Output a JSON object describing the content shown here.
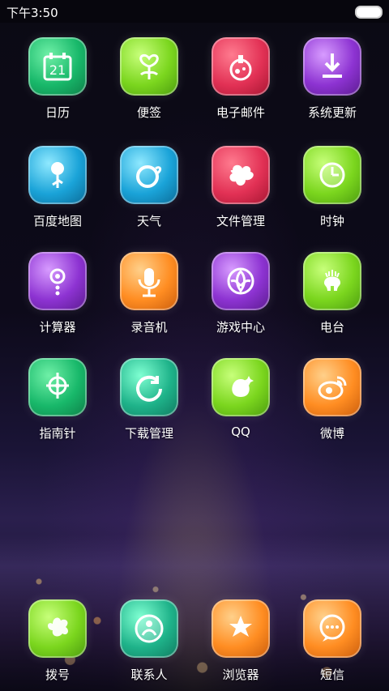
{
  "status_bar": {
    "time": "下午3:50"
  },
  "apps": [
    {
      "label": "日历",
      "icon": "calendar-icon",
      "badge": "21"
    },
    {
      "label": "便签",
      "icon": "notes-icon"
    },
    {
      "label": "电子邮件",
      "icon": "email-icon"
    },
    {
      "label": "系统更新",
      "icon": "download-icon"
    },
    {
      "label": "百度地图",
      "icon": "map-pin-icon"
    },
    {
      "label": "天气",
      "icon": "weather-icon"
    },
    {
      "label": "文件管理",
      "icon": "file-manager-icon"
    },
    {
      "label": "时钟",
      "icon": "clock-icon"
    },
    {
      "label": "计算器",
      "icon": "calculator-icon"
    },
    {
      "label": "录音机",
      "icon": "microphone-icon"
    },
    {
      "label": "游戏中心",
      "icon": "game-center-icon"
    },
    {
      "label": "电台",
      "icon": "radio-icon"
    },
    {
      "label": "指南针",
      "icon": "compass-icon"
    },
    {
      "label": "下载管理",
      "icon": "download-manager-icon"
    },
    {
      "label": "QQ",
      "icon": "qq-icon"
    },
    {
      "label": "微博",
      "icon": "weibo-icon"
    }
  ],
  "dock": [
    {
      "label": "拨号",
      "icon": "phone-icon"
    },
    {
      "label": "联系人",
      "icon": "contacts-icon"
    },
    {
      "label": "浏览器",
      "icon": "browser-icon"
    },
    {
      "label": "短信",
      "icon": "messages-icon"
    }
  ]
}
